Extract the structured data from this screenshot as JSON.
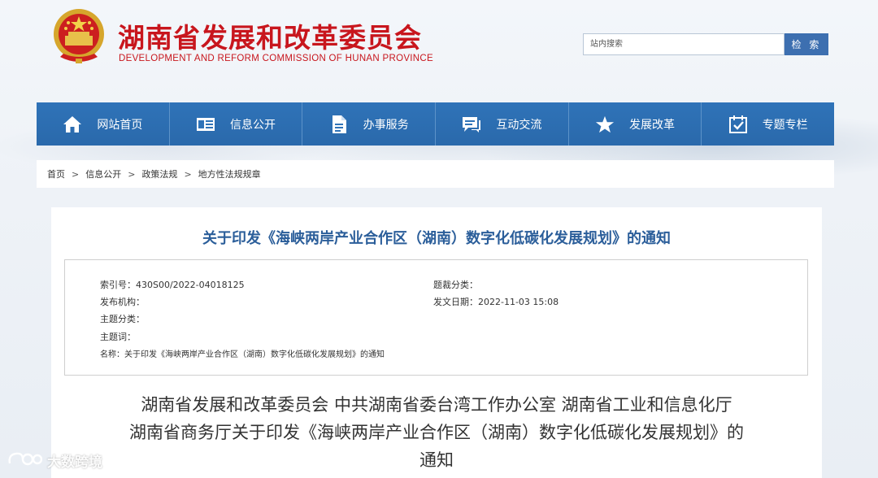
{
  "header": {
    "title": "湖南省发展和改革委员会",
    "subtitle": "DEVELOPMENT AND REFORM COMMISSION OF HUNAN PROVINCE",
    "search_placeholder": "站内搜索",
    "search_button": "检 索"
  },
  "nav": {
    "items": [
      {
        "label": "网站首页",
        "icon": "home-icon"
      },
      {
        "label": "信息公开",
        "icon": "id-card-icon"
      },
      {
        "label": "办事服务",
        "icon": "document-icon"
      },
      {
        "label": "互动交流",
        "icon": "chat-icon"
      },
      {
        "label": "发展改革",
        "icon": "star-icon"
      },
      {
        "label": "专题专栏",
        "icon": "calendar-check-icon"
      }
    ]
  },
  "breadcrumb": {
    "items": [
      "首页",
      "信息公开",
      "政策法规",
      "地方性法规规章"
    ],
    "separator": ">"
  },
  "article": {
    "title": "关于印发《海峡两岸产业合作区（湖南）数字化低碳化发展规划》的通知",
    "meta": {
      "index_no": "索引号：430S00/2022-04018125",
      "category": "题裁分类：",
      "publisher": "发布机构：",
      "publish_date": "发文日期：2022-11-03 15:08",
      "topic_category": "主题分类：",
      "keywords": "主题词：",
      "name": "名称：关于印发《海峡两岸产业合作区（湖南）数字化低碳化发展规划》的通知"
    },
    "body_heading": [
      "湖南省发展和改革委员会  中共湖南省委台湾工作办公室  湖南省工业和信息化厅",
      "湖南省商务厅关于印发《海峡两岸产业合作区（湖南）数字化低碳化发展规划》的",
      "通知"
    ]
  },
  "watermark": {
    "text": "大数跨境"
  },
  "colors": {
    "brand_red": "#c8161d",
    "nav_blue": "#2f73b8",
    "title_blue": "#2b5e9a"
  }
}
